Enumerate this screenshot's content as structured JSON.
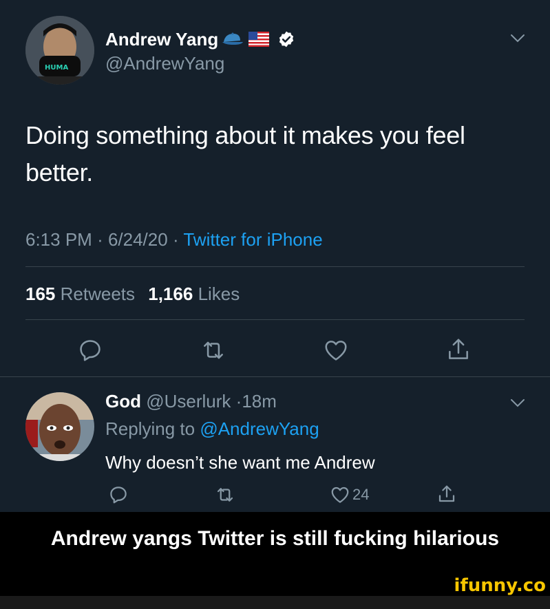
{
  "tweet": {
    "author_name": "Andrew Yang",
    "author_handle": "@AndrewYang",
    "text_line1": "Doing something about it makes you feel",
    "text_line2": "better.",
    "time": "6:13 PM",
    "date": "6/24/20",
    "source": "Twitter for iPhone",
    "retweets_count": "165",
    "retweets_label": "Retweets",
    "likes_count": "1,166",
    "likes_label": "Likes",
    "mask_text": "HUMA"
  },
  "reply": {
    "author_name": "God",
    "author_handle": "@Userlurk",
    "age": "18m",
    "replying_prefix": "Replying to",
    "replying_handle": "@AndrewYang",
    "text": "Why doesn’t she want me Andrew",
    "likes_count": "24"
  },
  "caption": "Andrew yangs Twitter is still fucking hilarious",
  "watermark": "ifunny.co",
  "colors": {
    "background": "#15202b",
    "link": "#1da1f2",
    "secondary_text": "#8899a6",
    "divider": "#38444d",
    "watermark": "#f7c600"
  },
  "icons": [
    "cap-icon",
    "us-flag-icon",
    "verified-badge-icon",
    "chevron-down-icon",
    "reply-icon",
    "retweet-icon",
    "like-icon",
    "share-icon"
  ]
}
